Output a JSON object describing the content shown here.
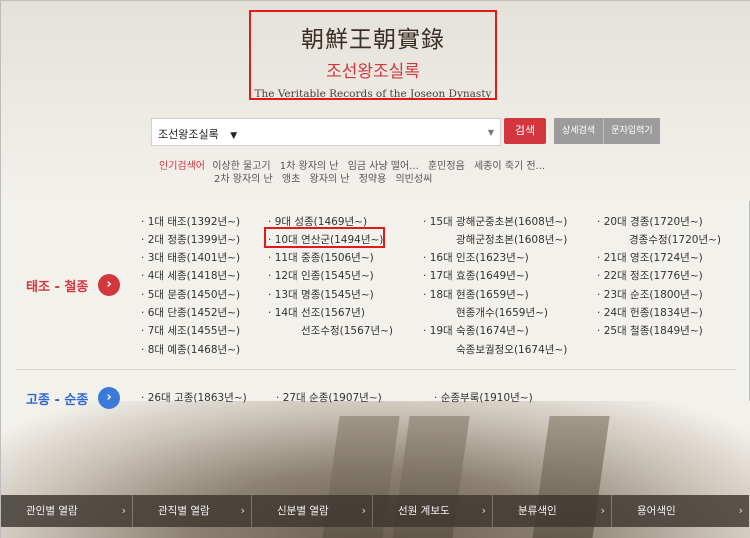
{
  "header": {
    "title_hanja": "朝鮮王朝實錄",
    "title_korean": "조선왕조실록",
    "title_english": "The Veritable Records of the Joseon Dynasty"
  },
  "search": {
    "selected": "조선왕조실록",
    "search_button": "검색",
    "advanced_button": "상세검색",
    "char_input_button": "문자입력기"
  },
  "popular": {
    "label": "인기검색어",
    "keywords": [
      "이상한 물고기",
      "1차 왕자의 난",
      "임금 사냥 떨어...",
      "훈민정음",
      "세종이 죽기 전...",
      "2차 왕자의 난",
      "앵초",
      "왕자의 난",
      "정약용",
      "의빈성씨"
    ]
  },
  "sections": {
    "first_label": "태조 - 철종",
    "second_label": "고종 - 순종"
  },
  "reigns": {
    "col1": [
      "1대 태조(1392년~)",
      "2대 정종(1399년~)",
      "3대 태종(1401년~)",
      "4대 세종(1418년~)",
      "5대 문종(1450년~)",
      "6대 단종(1452년~)",
      "7대 세조(1455년~)",
      "8대 예종(1468년~)"
    ],
    "col2": [
      "9대 성종(1469년~)",
      "10대 연산군(1494년~)",
      "11대 중종(1506년~)",
      "12대 인종(1545년~)",
      "13대 명종(1545년~)",
      "14대 선조(1567년)",
      "선조수정(1567년~)"
    ],
    "col3": [
      "15대 광해군중초본(1608년~)",
      "광해군정초본(1608년~)",
      "16대 인조(1623년~)",
      "17대 효종(1649년~)",
      "18대 현종(1659년~)",
      "현종개수(1659년~)",
      "19대 숙종(1674년~)",
      "숙종보궐정오(1674년~)"
    ],
    "col4": [
      "20대 경종(1720년~)",
      "경종수정(1720년~)",
      "21대 영조(1724년~)",
      "22대 정조(1776년~)",
      "23대 순조(1800년~)",
      "24대 헌종(1834년~)",
      "25대 철종(1849년~)"
    ],
    "later": [
      "26대 고종(1863년~)",
      "27대 순종(1907년~)",
      "순종부록(1910년~)"
    ]
  },
  "bottom_nav": [
    "관인별 열람",
    "관직별 열람",
    "신분별 열람",
    "선원 계보도",
    "분류색인",
    "용어색인"
  ],
  "colors": {
    "accent_red": "#d2373e",
    "accent_blue": "#3b7ad9",
    "highlight_box": "#e01b1b"
  }
}
